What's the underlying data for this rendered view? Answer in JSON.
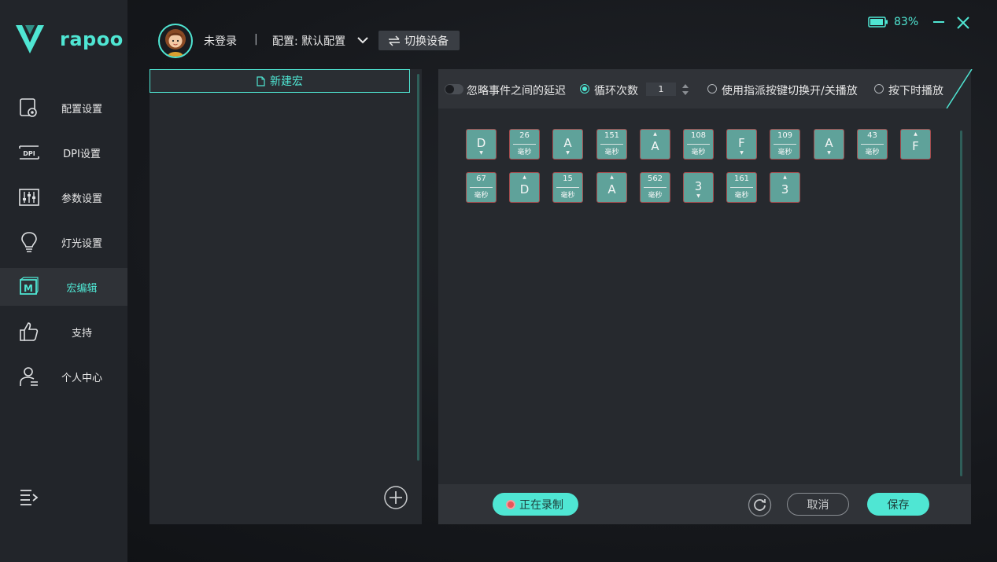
{
  "brand": {
    "logo_text": "rapoo"
  },
  "sidebar": {
    "items": [
      {
        "label": "配置设置",
        "icon": "config-icon"
      },
      {
        "label": "DPI设置",
        "icon": "dpi-icon"
      },
      {
        "label": "参数设置",
        "icon": "sliders-icon"
      },
      {
        "label": "灯光设置",
        "icon": "bulb-icon"
      },
      {
        "label": "宏编辑",
        "icon": "macro-icon",
        "active": true
      },
      {
        "label": "支持",
        "icon": "thumbs-up-icon"
      },
      {
        "label": "个人中心",
        "icon": "user-icon"
      }
    ],
    "menu_icon": "menu-expand-icon"
  },
  "header": {
    "login_status": "未登录",
    "separator": "|",
    "config": "配置: 默认配置",
    "switch_device": "切换设备",
    "battery": "83%"
  },
  "macro_list": {
    "items": [
      {
        "label": "新建宏"
      }
    ]
  },
  "options": {
    "ignore_delay": "忽略事件之间的延迟",
    "loop_count_label": "循环次数",
    "loop_count_value": "1",
    "toggle_mode": "使用指派按键切换开/关播放",
    "hold_mode": "按下时播放"
  },
  "events": [
    {
      "type": "key",
      "key": "D",
      "dir": "down"
    },
    {
      "type": "delay",
      "ms": "26",
      "unit": "毫秒"
    },
    {
      "type": "key",
      "key": "A",
      "dir": "down"
    },
    {
      "type": "delay",
      "ms": "151",
      "unit": "毫秒"
    },
    {
      "type": "key",
      "key": "A",
      "dir": "up"
    },
    {
      "type": "delay",
      "ms": "108",
      "unit": "毫秒"
    },
    {
      "type": "key",
      "key": "F",
      "dir": "down"
    },
    {
      "type": "delay",
      "ms": "109",
      "unit": "毫秒"
    },
    {
      "type": "key",
      "key": "A",
      "dir": "down"
    },
    {
      "type": "delay",
      "ms": "43",
      "unit": "毫秒"
    },
    {
      "type": "key",
      "key": "F",
      "dir": "up"
    },
    {
      "type": "delay",
      "ms": "67",
      "unit": "毫秒"
    },
    {
      "type": "key",
      "key": "D",
      "dir": "up"
    },
    {
      "type": "delay",
      "ms": "15",
      "unit": "毫秒"
    },
    {
      "type": "key",
      "key": "A",
      "dir": "up"
    },
    {
      "type": "delay",
      "ms": "562",
      "unit": "毫秒"
    },
    {
      "type": "key",
      "key": "3",
      "dir": "down"
    },
    {
      "type": "delay",
      "ms": "161",
      "unit": "毫秒"
    },
    {
      "type": "key",
      "key": "3",
      "dir": "up"
    }
  ],
  "bottom": {
    "record": "正在录制",
    "cancel": "取消",
    "save": "保存"
  },
  "colors": {
    "accent": "#4fe6d3",
    "key_bg": "#5fa29a",
    "key_border": "#a44d4f"
  }
}
